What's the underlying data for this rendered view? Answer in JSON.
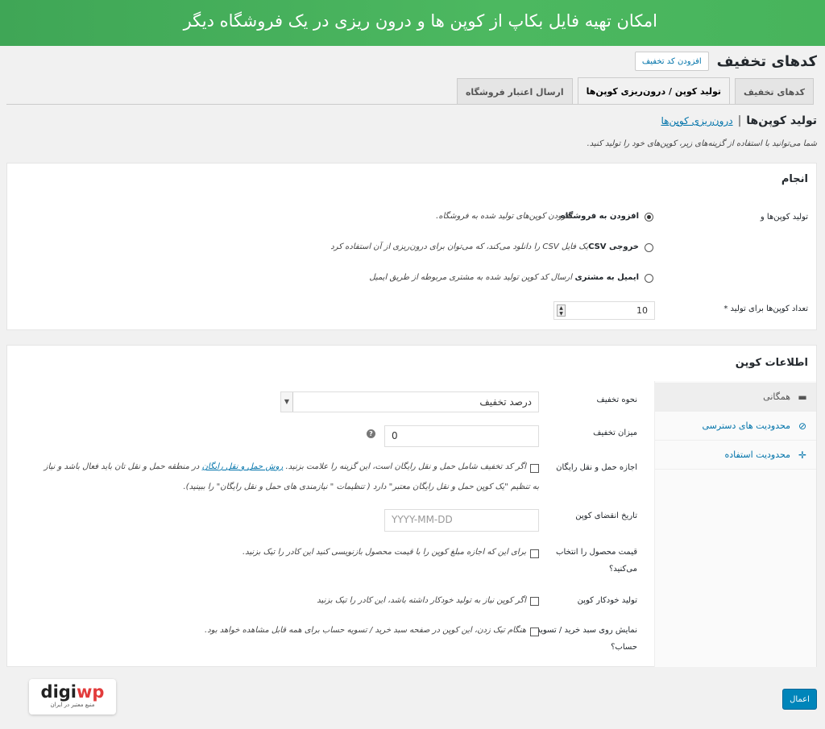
{
  "banner": {
    "text": "امکان تهیه فایل بکاپ از کوپن ها و درون ریزی در یک فروشگاه دیگر"
  },
  "header": {
    "title": "کدهای تخفیف",
    "add_button": "افزودن کد تخفیف"
  },
  "tabs": [
    {
      "label": "کدهای تخفیف",
      "active": false
    },
    {
      "label": "تولید کوپن / درون‌ریزی کوپن‌ها",
      "active": true
    },
    {
      "label": "ارسال اعتبار فروشگاه",
      "active": false
    }
  ],
  "subheader": {
    "title": "تولید کوپن‌ها",
    "separator": "|",
    "link": "درون‌ریزی کوپن‌ها",
    "description": "شما می‌توانید با استفاده از گزینه‌های زیر، کوپن‌های خود را تولید کنید."
  },
  "action_box": {
    "title": "انجام",
    "generate_label": "تولید کوپن‌ها و",
    "options": [
      {
        "label": "افزودن به فروشگاه",
        "description": "افزودن کوپن‌های تولید شده به فروشگاه.",
        "selected": true
      },
      {
        "label": "خروجی CSV",
        "description": "یک فایل CSV را دانلود می‌کند، که می‌توان برای درون‌ریزی از آن استفاده کرد",
        "selected": false
      },
      {
        "label": "ایمیل به مشتری",
        "description": "ارسال کد کوپن تولید شده به مشتری مربوطه از طریق ایمیل",
        "selected": false
      }
    ],
    "count_label": "تعداد کوپن‌ها برای تولید *",
    "count_value": "10"
  },
  "coupon_box": {
    "title": "اطلاعات کوپن",
    "side_tabs": [
      {
        "label": "همگانی",
        "icon": "ticket-icon",
        "active": true
      },
      {
        "label": "محدودیت های دسترسی",
        "icon": "block-icon",
        "active": false
      },
      {
        "label": "محدودیت استفاده",
        "icon": "arrows-icon",
        "active": false
      }
    ],
    "discount_type_label": "نحوه تخفیف",
    "discount_type_value": "درصد تخفیف",
    "amount_label": "میزان تخفیف",
    "amount_value": "0",
    "free_shipping_label": "اجازه حمل و نقل رایگان",
    "free_shipping_desc_1": "اگر کد تخفیف شامل حمل و نقل رایگان است، این گزینه را علامت بزنید.",
    "free_shipping_link": "روش حمل و نقل رایگان",
    "free_shipping_desc_2": "در منطقه حمل و نقل تان باید فعال باشد و نیاز",
    "free_shipping_desc_3": "به تنظیم \"یک کوپن حمل و نقل رایگان معتبر\" دارد ( تنظیمات \" نیازمندی های حمل و نقل رایگان\" را ببینید).",
    "expiry_label": "تاریخ انقضای کوپن",
    "expiry_placeholder": "YYYY-MM-DD",
    "price_label_1": "قیمت محصول را انتخاب",
    "price_label_2": "می‌کنید؟",
    "price_desc": "برای این که اجازه مبلغ کوپن را با قیمت محصول بازنویسی کنید این کادر را تیک بزنید.",
    "auto_label": "تولید خودکار کوپن",
    "auto_desc": "اگر کوپن نیاز به تولید خودکار داشته باشد، این کادر را تیک بزنید",
    "cart_label_1": "نمایش روی سبد خرید / تسویه",
    "cart_label_2": "حساب؟",
    "cart_desc": "هنگام تیک زدن، این کوپن در صفحه سبد خرید / تسویه حساب برای همه قابل مشاهده خواهد بود."
  },
  "apply_button": "اعمال",
  "logo": {
    "word_a": "digi",
    "word_b": "wp",
    "tagline": "منبع معتبر در ایران"
  },
  "colors": {
    "banner": "#47b45c",
    "link": "#0073aa",
    "primary_button": "#0085ba"
  }
}
